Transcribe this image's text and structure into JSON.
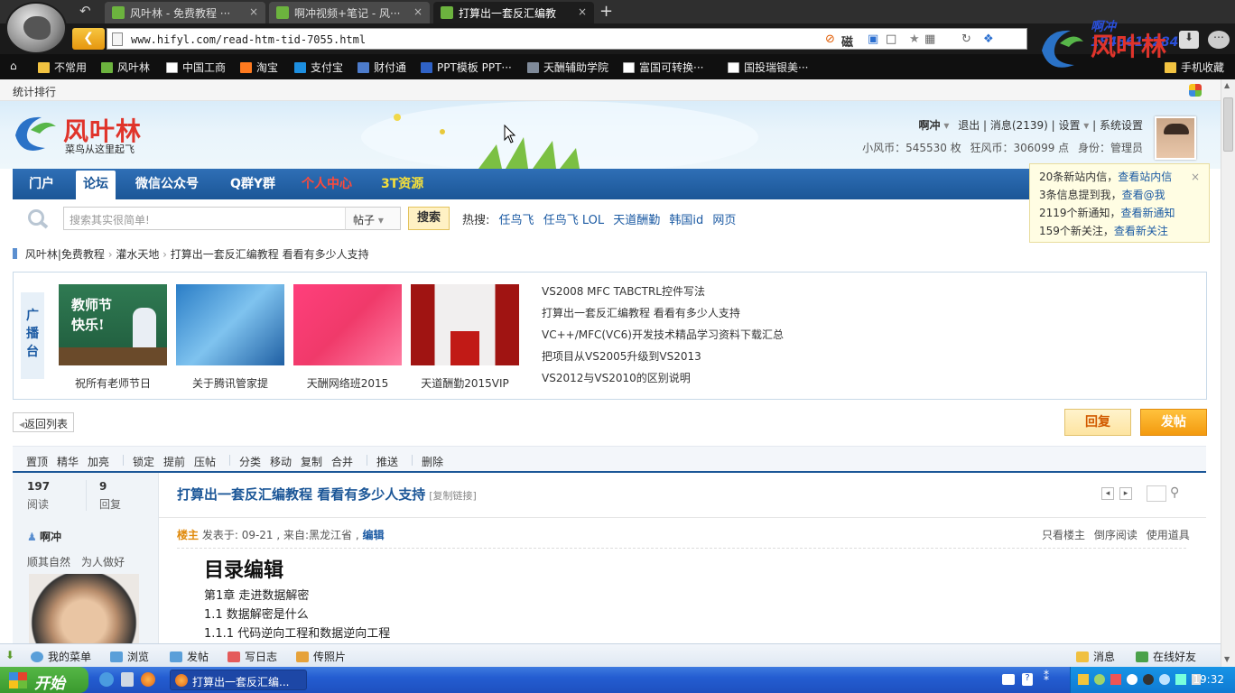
{
  "browser": {
    "tabs": [
      {
        "label": "风叶林 - 免费教程 ···"
      },
      {
        "label": "啊冲视频+笔记 - 风···"
      },
      {
        "label": "打算出一套反汇编教"
      }
    ],
    "url": "www.hifyl.com/read-htm-tid-7055.html",
    "toolbar_text": "磁",
    "bookmarks": [
      "不常用",
      "风叶林",
      "中国工商",
      "淘宝",
      "支付宝",
      "财付通",
      "PPT模板 PPT···",
      "天酬辅助学院",
      "富国可转换···",
      "国投瑞银美···"
    ],
    "mobile_fav": "手机收藏",
    "watermark": {
      "top": "啊冲 1848612284",
      "brand": "风叶林"
    }
  },
  "site": {
    "top_link": "统计排行",
    "logo_name": "风叶林",
    "logo_slogan": "菜鸟从这里起飞",
    "user": {
      "name": "啊冲",
      "logout": "退出",
      "messages": "消息(2139)",
      "settings": "设置",
      "system": "系统设置",
      "coins": "小风币：545530 枚",
      "wealth": "狂风币：306099 点",
      "identity": "身份：管理员"
    },
    "nav": [
      "门户",
      "论坛",
      "微信公众号",
      "Q群Y群",
      "个人中心",
      "3T资源"
    ],
    "search": {
      "placeholder": "搜索其实很简单!",
      "type": "帖子",
      "button": "搜索",
      "hot_label": "热搜:",
      "hot": [
        "任鸟飞",
        "任鸟飞 LOL",
        "天道酬勤",
        "韩国id",
        "网页"
      ]
    },
    "notify": {
      "line1_a": "20条新站内信，",
      "line1_b": "查看站内信",
      "line2_a": "3条信息提到我，",
      "line2_b": "查看@我",
      "line3_a": "2119个新通知，",
      "line3_b": "查看新通知",
      "line4_a": "159个新关注，",
      "line4_b": "查看新关注"
    },
    "breadcrumb": [
      "风叶林|免费教程",
      "灌水天地",
      "打算出一套反汇编教程 看看有多少人支持"
    ],
    "broadcast": {
      "label": "广播台",
      "images": [
        {
          "caption": "祝所有老师节日",
          "overlay": "教师节快乐!"
        },
        {
          "caption": "关于腾讯管家提"
        },
        {
          "caption": "天酬网络班2015"
        },
        {
          "caption": "天道酬勤2015VIP"
        }
      ],
      "links": [
        "VS2008 MFC TABCTRL控件写法",
        "打算出一套反汇编教程 看看有多少人支持",
        "VC++/MFC(VC6)开发技术精品学习资料下载汇总",
        "把项目从VS2005升级到VS2013",
        "VS2012与VS2010的区别说明"
      ]
    },
    "back_list": "返回列表",
    "reply_btn": "回复",
    "post_btn": "发帖",
    "mod_tools": [
      "置顶",
      "精华",
      "加亮",
      "锁定",
      "提前",
      "压帖",
      "分类",
      "移动",
      "复制",
      "合并",
      "推送",
      "删除"
    ],
    "thread": {
      "views": "197",
      "views_label": "阅读",
      "replies": "9",
      "replies_label": "回复",
      "title": "打算出一套反汇编教程 看看有多少人支持",
      "copy_link": "[复制链接]"
    },
    "post": {
      "author": "啊冲",
      "author_sig1": "顺其自然",
      "author_sig2": "为人做好",
      "floor": "楼主",
      "meta": "发表于: 09-21 , 来自:黑龙江省 ,",
      "edit": "编辑",
      "only_author": "只看楼主",
      "reverse": "倒序阅读",
      "tools": "使用道具",
      "heading": "目录编辑",
      "lines": [
        "第1章 走进数据解密",
        "1.1 数据解密是什么",
        "1.1.1 代码逆向工程和数据逆向工程"
      ]
    },
    "bottom_bar": {
      "menu": "我的菜单",
      "browse": "浏览",
      "post": "发帖",
      "blog": "写日志",
      "photo": "传照片",
      "msg": "消息",
      "online": "在线好友"
    }
  },
  "taskbar": {
    "start": "开始",
    "app": "打算出一套反汇编...",
    "clock": "19:32"
  }
}
